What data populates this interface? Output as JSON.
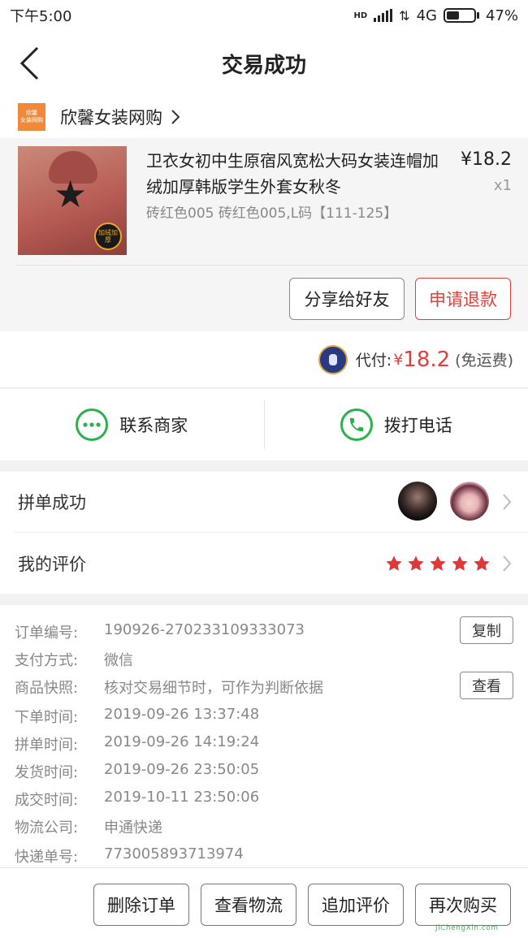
{
  "status_bar": {
    "time": "下午5:00",
    "hd": "HD",
    "network": "4G",
    "battery": "47%",
    "battery_level": 0.47
  },
  "header": {
    "title": "交易成功"
  },
  "shop": {
    "name": "欣馨女装网购",
    "logo_text_1": "欣馨",
    "logo_text_2": "女装网购"
  },
  "product": {
    "title": "卫衣女初中生原宿风宽松大码女装连帽加绒加厚韩版学生外套女秋冬",
    "spec": "砖红色005 砖红色005,L码【111-125】",
    "price": "¥18.2",
    "qty": "x1",
    "badge_text": "加绒加厚",
    "share_label": "分享给好友",
    "refund_label": "申请退款"
  },
  "payment": {
    "label": "代付:",
    "currency": "¥",
    "amount": "18.2",
    "note": "(免运费)"
  },
  "contact": {
    "merchant_label": "联系商家",
    "call_label": "拨打电话"
  },
  "group": {
    "label": "拼单成功"
  },
  "review": {
    "label": "我的评价",
    "rating": 5,
    "max_rating": 5
  },
  "details": {
    "order_no_key": "订单编号:",
    "order_no": "190926-270233109333073",
    "copy_label": "复制",
    "pay_method_key": "支付方式:",
    "pay_method": "微信",
    "snapshot_key": "商品快照:",
    "snapshot": "核对交易细节时，可作为判断依据",
    "view_label": "查看",
    "order_time_key": "下单时间:",
    "order_time": "2019-09-26 13:37:48",
    "group_time_key": "拼单时间:",
    "group_time": "2019-09-26 14:19:24",
    "ship_time_key": "发货时间:",
    "ship_time": "2019-09-26 23:50:05",
    "deal_time_key": "成交时间:",
    "deal_time": "2019-10-11 23:50:06",
    "logistics_key": "物流公司:",
    "logistics": "申通快递",
    "tracking_key": "快递单号:",
    "tracking": "773005893713974"
  },
  "actions": {
    "delete": "删除订单",
    "logistics": "查看物流",
    "add_review": "追加评价",
    "rebuy": "再次购买"
  },
  "watermark": {
    "text": "JiChengXin.com"
  },
  "colors": {
    "accent_red": "#e0403a",
    "green": "#2bb14a",
    "star_red": "#e03838",
    "shop_orange": "#f08a3a"
  }
}
